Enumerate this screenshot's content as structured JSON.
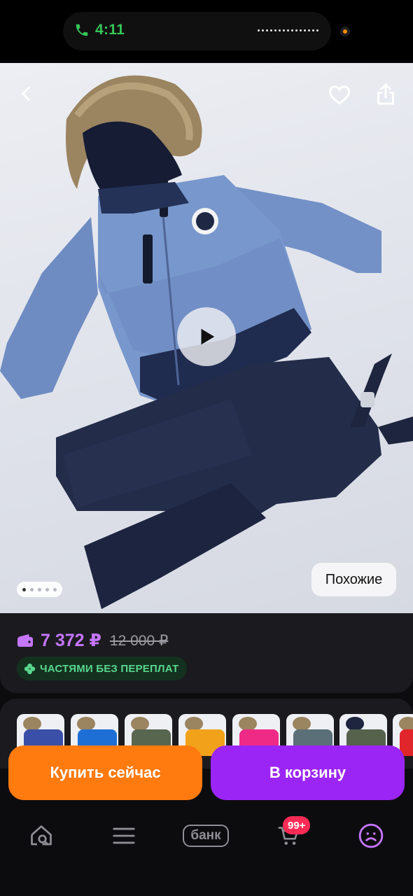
{
  "status_bar": {
    "time": "4:11"
  },
  "gallery": {
    "similar_label": "Похожие",
    "slide_count": 5,
    "active_slide": 1
  },
  "price": {
    "current": "7 372 ₽",
    "old": "12 000 ₽",
    "installment_badge": "ЧАСТЯМИ БЕЗ ПЕРЕПЛАТ"
  },
  "variants": {
    "colors": [
      "#3a4fa8",
      "#1d6fd6",
      "#59664f",
      "#f2a21a",
      "#ee2a86",
      "#5a6f78",
      "#56624c",
      "#e0262b"
    ]
  },
  "actions": {
    "buy_now": "Купить сейчас",
    "add_to_cart": "В корзину"
  },
  "tabbar": {
    "bank_label": "банк",
    "cart_badge": "99+"
  },
  "colors": {
    "accent_purple": "#9b25f5",
    "accent_orange": "#ff7a0f",
    "price_purple": "#c576ff",
    "badge_green": "#58d68d",
    "cart_badge_red": "#ff2b55"
  }
}
